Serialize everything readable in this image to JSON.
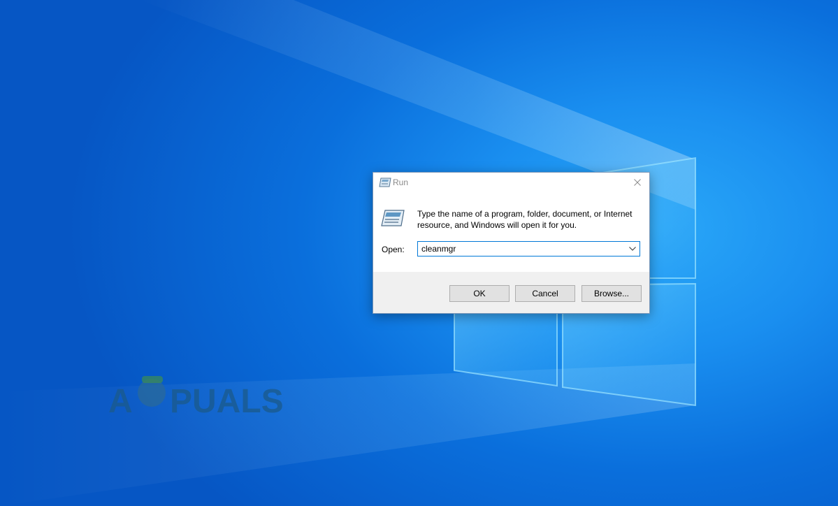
{
  "desktop": {
    "background_color": "#0a78e0",
    "watermark_text": "APPUALS"
  },
  "run_dialog": {
    "title": "Run",
    "description": "Type the name of a program, folder, document, or Internet resource, and Windows will open it for you.",
    "open_label": "Open:",
    "open_value": "cleanmgr",
    "buttons": {
      "ok": "OK",
      "cancel": "Cancel",
      "browse": "Browse..."
    },
    "icons": {
      "title": "run-icon",
      "body": "run-icon",
      "close": "close-icon",
      "dropdown": "chevron-down-icon"
    },
    "accent_color": "#0078d7"
  }
}
